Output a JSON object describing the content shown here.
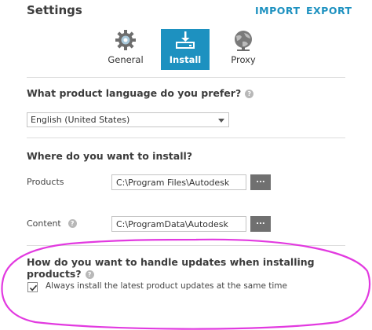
{
  "header": {
    "title": "Settings",
    "import_label": "IMPORT",
    "export_label": "EXPORT"
  },
  "tabs": [
    {
      "label": "General",
      "icon": "gear-icon",
      "active": false
    },
    {
      "label": "Install",
      "icon": "install-download-icon",
      "active": true
    },
    {
      "label": "Proxy",
      "icon": "globe-network-icon",
      "active": false
    }
  ],
  "language": {
    "question": "What product language do you prefer?",
    "selected": "English (United States)"
  },
  "install_location": {
    "question": "Where do you want to install?",
    "products_label": "Products",
    "products_path": "C:\\Program Files\\Autodesk",
    "content_label": "Content",
    "content_path": "C:\\ProgramData\\Autodesk",
    "browse_label": "..."
  },
  "updates": {
    "question": "How do you want to handle updates when installing products?",
    "checkbox_label": "Always install the latest product updates at the same time",
    "checked": true
  },
  "colors": {
    "accent": "#1d91c0",
    "annotation": "#e23ae0"
  }
}
